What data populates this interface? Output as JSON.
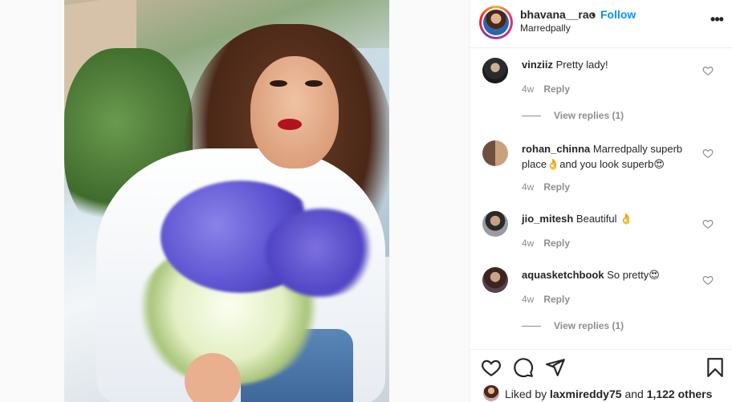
{
  "post": {
    "username": "bhavana__rao",
    "separator": "•",
    "follow_label": "Follow",
    "location": "Marredpally",
    "more_icon": "more-horizontal-icon"
  },
  "comments": [
    {
      "username": "vinziiz",
      "text": "Pretty lady!",
      "age": "4w",
      "reply_label": "Reply",
      "view_replies": "View replies (1)"
    },
    {
      "username": "rohan_chinna",
      "text_line1": "Marredpally superb",
      "text_line2": "place👌and you look superb😍",
      "age": "4w",
      "reply_label": "Reply"
    },
    {
      "username": "jio_mitesh",
      "text": "Beautiful 👌",
      "age": "4w",
      "reply_label": "Reply"
    },
    {
      "username": "aquasketchbook",
      "text": "So pretty😍",
      "age": "4w",
      "reply_label": "Reply",
      "view_replies": "View replies (1)"
    }
  ],
  "actions": {
    "like_icon": "heart-icon",
    "comment_icon": "comment-icon",
    "share_icon": "share-icon",
    "save_icon": "bookmark-icon"
  },
  "likes": {
    "prefix": "Liked by",
    "user": "laxmireddy75",
    "conjunction": "and",
    "others": "1,122 others"
  }
}
